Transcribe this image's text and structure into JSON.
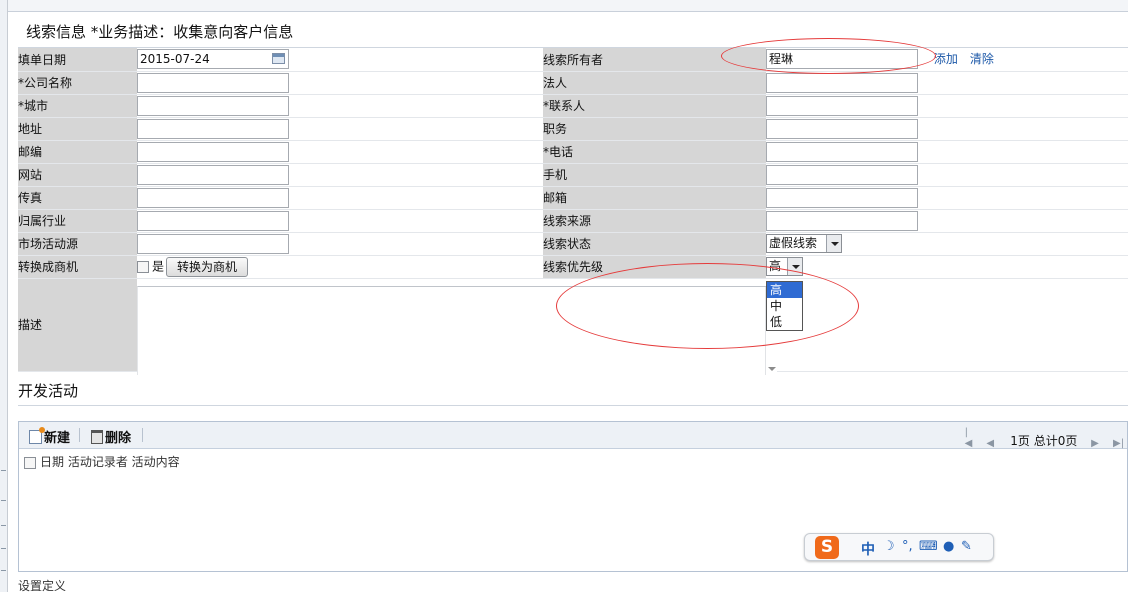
{
  "section_title": "线索信息 *业务描述：收集意向客户信息",
  "rows": [
    {
      "left_label": "填单日期",
      "left_value": "2015-07-24",
      "right_label": "线索所有者",
      "right_value": "程琳"
    },
    {
      "left_label": "*公司名称",
      "left_value": "",
      "right_label": "法人",
      "right_value": ""
    },
    {
      "left_label": "*城市",
      "left_value": "",
      "right_label": "*联系人",
      "right_value": ""
    },
    {
      "left_label": "地址",
      "left_value": "",
      "right_label": "职务",
      "right_value": ""
    },
    {
      "left_label": "邮编",
      "left_value": "",
      "right_label": "*电话",
      "right_value": ""
    },
    {
      "left_label": "网站",
      "left_value": "",
      "right_label": "手机",
      "right_value": ""
    },
    {
      "left_label": "传真",
      "left_value": "",
      "right_label": "邮箱",
      "right_value": ""
    },
    {
      "left_label": "归属行业",
      "left_value": "",
      "right_label": "线索来源",
      "right_value": ""
    },
    {
      "left_label": "市场活动源",
      "left_value": "",
      "right_label": "线索状态",
      "right_value": "虚假线索"
    },
    {
      "left_label": "转换成商机",
      "left_value": "",
      "right_label": "线索优先级",
      "right_value": "高"
    }
  ],
  "owner_links": {
    "add": "添加",
    "clear": "清除"
  },
  "convert": {
    "checkbox_label": "是",
    "button_label": "转换为商机"
  },
  "priority_options": [
    "高",
    "中",
    "低"
  ],
  "description_label": "描述",
  "dev_title": "开发活动",
  "toolbar": {
    "new_label": "新建",
    "delete_label": "删除",
    "pager_text": "1页 总计0页"
  },
  "grid_header": "日期 活动记录者 活动内容",
  "ime": {
    "logo": "S",
    "mode": "中",
    "moon": "☽",
    "punct": "°,",
    "keyboard": "⌨",
    "user": "●",
    "tool": "✎"
  },
  "bottom_text": "设置定义"
}
